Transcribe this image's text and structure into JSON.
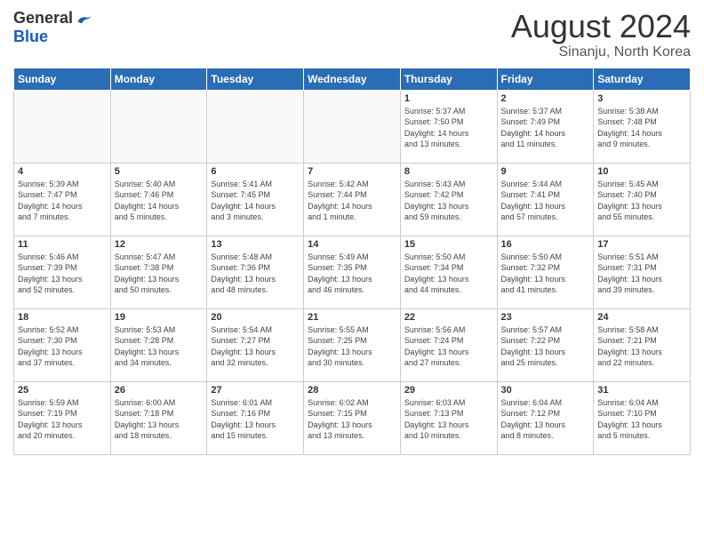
{
  "header": {
    "logo_general": "General",
    "logo_blue": "Blue",
    "title": "August 2024",
    "subtitle": "Sinanju, North Korea"
  },
  "days_of_week": [
    "Sunday",
    "Monday",
    "Tuesday",
    "Wednesday",
    "Thursday",
    "Friday",
    "Saturday"
  ],
  "weeks": [
    [
      {
        "day": "",
        "info": ""
      },
      {
        "day": "",
        "info": ""
      },
      {
        "day": "",
        "info": ""
      },
      {
        "day": "",
        "info": ""
      },
      {
        "day": "1",
        "info": "Sunrise: 5:37 AM\nSunset: 7:50 PM\nDaylight: 14 hours\nand 13 minutes."
      },
      {
        "day": "2",
        "info": "Sunrise: 5:37 AM\nSunset: 7:49 PM\nDaylight: 14 hours\nand 11 minutes."
      },
      {
        "day": "3",
        "info": "Sunrise: 5:38 AM\nSunset: 7:48 PM\nDaylight: 14 hours\nand 9 minutes."
      }
    ],
    [
      {
        "day": "4",
        "info": "Sunrise: 5:39 AM\nSunset: 7:47 PM\nDaylight: 14 hours\nand 7 minutes."
      },
      {
        "day": "5",
        "info": "Sunrise: 5:40 AM\nSunset: 7:46 PM\nDaylight: 14 hours\nand 5 minutes."
      },
      {
        "day": "6",
        "info": "Sunrise: 5:41 AM\nSunset: 7:45 PM\nDaylight: 14 hours\nand 3 minutes."
      },
      {
        "day": "7",
        "info": "Sunrise: 5:42 AM\nSunset: 7:44 PM\nDaylight: 14 hours\nand 1 minute."
      },
      {
        "day": "8",
        "info": "Sunrise: 5:43 AM\nSunset: 7:42 PM\nDaylight: 13 hours\nand 59 minutes."
      },
      {
        "day": "9",
        "info": "Sunrise: 5:44 AM\nSunset: 7:41 PM\nDaylight: 13 hours\nand 57 minutes."
      },
      {
        "day": "10",
        "info": "Sunrise: 5:45 AM\nSunset: 7:40 PM\nDaylight: 13 hours\nand 55 minutes."
      }
    ],
    [
      {
        "day": "11",
        "info": "Sunrise: 5:46 AM\nSunset: 7:39 PM\nDaylight: 13 hours\nand 52 minutes."
      },
      {
        "day": "12",
        "info": "Sunrise: 5:47 AM\nSunset: 7:38 PM\nDaylight: 13 hours\nand 50 minutes."
      },
      {
        "day": "13",
        "info": "Sunrise: 5:48 AM\nSunset: 7:36 PM\nDaylight: 13 hours\nand 48 minutes."
      },
      {
        "day": "14",
        "info": "Sunrise: 5:49 AM\nSunset: 7:35 PM\nDaylight: 13 hours\nand 46 minutes."
      },
      {
        "day": "15",
        "info": "Sunrise: 5:50 AM\nSunset: 7:34 PM\nDaylight: 13 hours\nand 44 minutes."
      },
      {
        "day": "16",
        "info": "Sunrise: 5:50 AM\nSunset: 7:32 PM\nDaylight: 13 hours\nand 41 minutes."
      },
      {
        "day": "17",
        "info": "Sunrise: 5:51 AM\nSunset: 7:31 PM\nDaylight: 13 hours\nand 39 minutes."
      }
    ],
    [
      {
        "day": "18",
        "info": "Sunrise: 5:52 AM\nSunset: 7:30 PM\nDaylight: 13 hours\nand 37 minutes."
      },
      {
        "day": "19",
        "info": "Sunrise: 5:53 AM\nSunset: 7:28 PM\nDaylight: 13 hours\nand 34 minutes."
      },
      {
        "day": "20",
        "info": "Sunrise: 5:54 AM\nSunset: 7:27 PM\nDaylight: 13 hours\nand 32 minutes."
      },
      {
        "day": "21",
        "info": "Sunrise: 5:55 AM\nSunset: 7:25 PM\nDaylight: 13 hours\nand 30 minutes."
      },
      {
        "day": "22",
        "info": "Sunrise: 5:56 AM\nSunset: 7:24 PM\nDaylight: 13 hours\nand 27 minutes."
      },
      {
        "day": "23",
        "info": "Sunrise: 5:57 AM\nSunset: 7:22 PM\nDaylight: 13 hours\nand 25 minutes."
      },
      {
        "day": "24",
        "info": "Sunrise: 5:58 AM\nSunset: 7:21 PM\nDaylight: 13 hours\nand 22 minutes."
      }
    ],
    [
      {
        "day": "25",
        "info": "Sunrise: 5:59 AM\nSunset: 7:19 PM\nDaylight: 13 hours\nand 20 minutes."
      },
      {
        "day": "26",
        "info": "Sunrise: 6:00 AM\nSunset: 7:18 PM\nDaylight: 13 hours\nand 18 minutes."
      },
      {
        "day": "27",
        "info": "Sunrise: 6:01 AM\nSunset: 7:16 PM\nDaylight: 13 hours\nand 15 minutes."
      },
      {
        "day": "28",
        "info": "Sunrise: 6:02 AM\nSunset: 7:15 PM\nDaylight: 13 hours\nand 13 minutes."
      },
      {
        "day": "29",
        "info": "Sunrise: 6:03 AM\nSunset: 7:13 PM\nDaylight: 13 hours\nand 10 minutes."
      },
      {
        "day": "30",
        "info": "Sunrise: 6:04 AM\nSunset: 7:12 PM\nDaylight: 13 hours\nand 8 minutes."
      },
      {
        "day": "31",
        "info": "Sunrise: 6:04 AM\nSunset: 7:10 PM\nDaylight: 13 hours\nand 5 minutes."
      }
    ]
  ]
}
